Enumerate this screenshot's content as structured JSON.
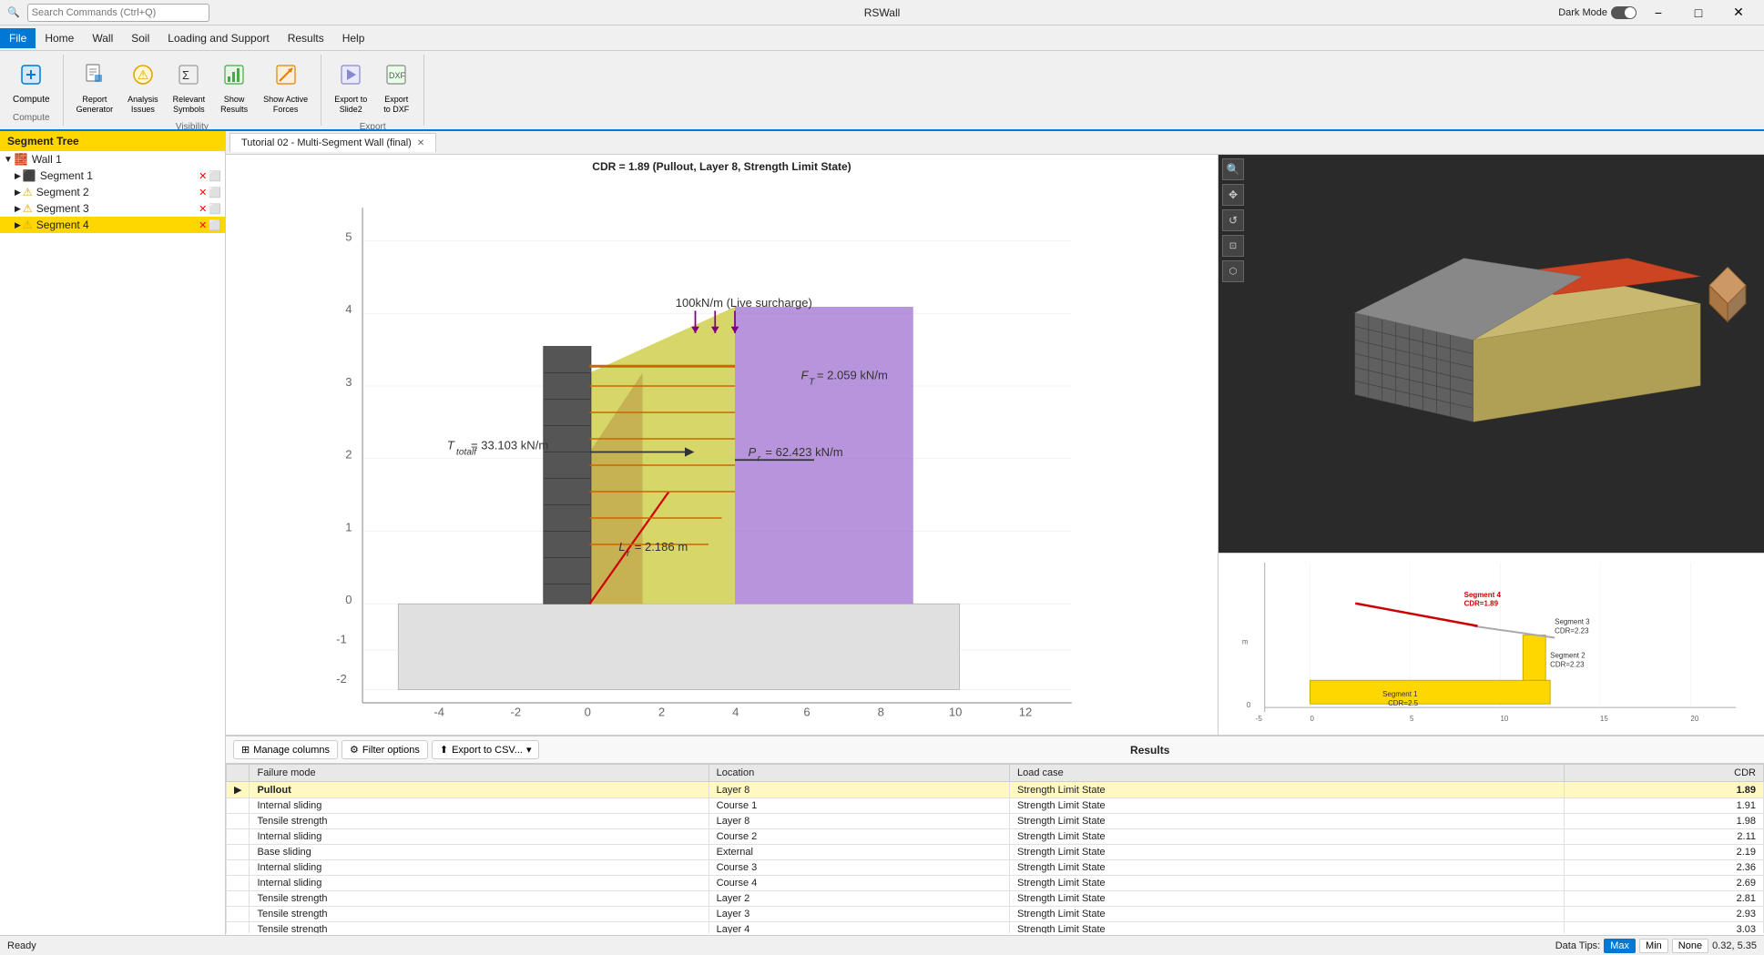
{
  "app": {
    "title": "RSWall",
    "search_placeholder": "Search Commands (Ctrl+Q)",
    "dark_mode_label": "Dark Mode"
  },
  "titlebar": {
    "minimize": "−",
    "maximize": "□",
    "close": "✕"
  },
  "menubar": {
    "items": [
      {
        "id": "file",
        "label": "File",
        "active": true
      },
      {
        "id": "home",
        "label": "Home"
      },
      {
        "id": "wall",
        "label": "Wall"
      },
      {
        "id": "soil",
        "label": "Soil"
      },
      {
        "id": "loading",
        "label": "Loading and Support"
      },
      {
        "id": "results",
        "label": "Results"
      },
      {
        "id": "help",
        "label": "Help"
      }
    ]
  },
  "ribbon": {
    "groups": [
      {
        "id": "compute",
        "label": "Compute",
        "buttons": [
          {
            "id": "compute",
            "label": "Compute",
            "icon": "⚙"
          }
        ]
      },
      {
        "id": "visibility",
        "label": "Visibility",
        "buttons": [
          {
            "id": "report-generator",
            "label": "Report\nGenerator",
            "icon": "📄"
          },
          {
            "id": "analysis-issues",
            "label": "Analysis\nIssues",
            "icon": "⚠"
          },
          {
            "id": "relevant-symbols",
            "label": "Relevant\nSymbols",
            "icon": "🔣"
          },
          {
            "id": "show-results",
            "label": "Show\nResults",
            "icon": "📊"
          },
          {
            "id": "show-active-forces",
            "label": "Show Active\nForces",
            "icon": "↗"
          }
        ]
      },
      {
        "id": "export",
        "label": "Export",
        "buttons": [
          {
            "id": "export-slide2",
            "label": "Export to\nSlide2",
            "icon": "📤"
          },
          {
            "id": "export-dxf",
            "label": "Export\nto DXF",
            "icon": "📐"
          }
        ]
      }
    ]
  },
  "sidebar": {
    "header": "Segment Tree",
    "items": [
      {
        "id": "wall1",
        "label": "Wall 1",
        "level": 0,
        "type": "wall",
        "icon": "🧱"
      },
      {
        "id": "seg1",
        "label": "Segment 1",
        "level": 1,
        "type": "segment",
        "warning": false
      },
      {
        "id": "seg2",
        "label": "Segment 2",
        "level": 1,
        "type": "segment",
        "warning": true
      },
      {
        "id": "seg3",
        "label": "Segment 3",
        "level": 1,
        "type": "segment",
        "warning": true
      },
      {
        "id": "seg4",
        "label": "Segment 4",
        "level": 1,
        "type": "segment",
        "warning": true,
        "selected": true
      }
    ]
  },
  "tab": {
    "label": "Tutorial 02 - Multi-Segment Wall (final)"
  },
  "chart": {
    "title": "CDR = 1.89 (Pullout, Layer 8, Strength Limit State)",
    "annotations": [
      {
        "text": "100kN/m (Live surcharge)"
      },
      {
        "text": "F_T = 2.059 kN/m"
      },
      {
        "text": "T_totalf = 33.103 kN/m"
      },
      {
        "text": "P_r = 62.423 kN/m"
      },
      {
        "text": "L_r = 2.186 m"
      }
    ]
  },
  "results_panel": {
    "title": "Results",
    "toolbar": {
      "manage_columns": "Manage columns",
      "filter_options": "Filter options",
      "export_csv": "Export to CSV..."
    },
    "columns": [
      "Failure mode",
      "Location",
      "Load case",
      "CDR"
    ],
    "rows": [
      {
        "id": "r1",
        "failure_mode": "Pullout",
        "location": "Layer 8",
        "load_case": "Strength Limit State",
        "cdr": "1.89",
        "selected": true
      },
      {
        "id": "r2",
        "failure_mode": "Internal sliding",
        "location": "Course 1",
        "load_case": "Strength Limit State",
        "cdr": "1.91"
      },
      {
        "id": "r3",
        "failure_mode": "Tensile strength",
        "location": "Layer 8",
        "load_case": "Strength Limit State",
        "cdr": "1.98"
      },
      {
        "id": "r4",
        "failure_mode": "Internal sliding",
        "location": "Course 2",
        "load_case": "Strength Limit State",
        "cdr": "2.11"
      },
      {
        "id": "r5",
        "failure_mode": "Base sliding",
        "location": "External",
        "load_case": "Strength Limit State",
        "cdr": "2.19"
      },
      {
        "id": "r6",
        "failure_mode": "Internal sliding",
        "location": "Course 3",
        "load_case": "Strength Limit State",
        "cdr": "2.36"
      },
      {
        "id": "r7",
        "failure_mode": "Internal sliding",
        "location": "Course 4",
        "load_case": "Strength Limit State",
        "cdr": "2.69"
      },
      {
        "id": "r8",
        "failure_mode": "Tensile strength",
        "location": "Layer 2",
        "load_case": "Strength Limit State",
        "cdr": "2.81"
      },
      {
        "id": "r9",
        "failure_mode": "Tensile strength",
        "location": "Layer 3",
        "load_case": "Strength Limit State",
        "cdr": "2.93"
      },
      {
        "id": "r10",
        "failure_mode": "Tensile strength",
        "location": "Layer 4",
        "load_case": "Strength Limit State",
        "cdr": "3.03"
      }
    ]
  },
  "statusbar": {
    "status": "Ready",
    "data_tips": "Data Tips:",
    "max": "Max",
    "min": "Min",
    "none": "None",
    "coords": "0.32, 5.35"
  },
  "segments_view": {
    "segments": [
      {
        "label": "Segment 4\nCDR=1.89",
        "color": "#e00"
      },
      {
        "label": "Segment 3\nCDR=2.23",
        "color": "#888"
      },
      {
        "label": "Segment 2\nCDR=2.23",
        "color": "#888"
      },
      {
        "label": "Segment 1\nCDR=2.5",
        "color": "#888"
      }
    ]
  }
}
